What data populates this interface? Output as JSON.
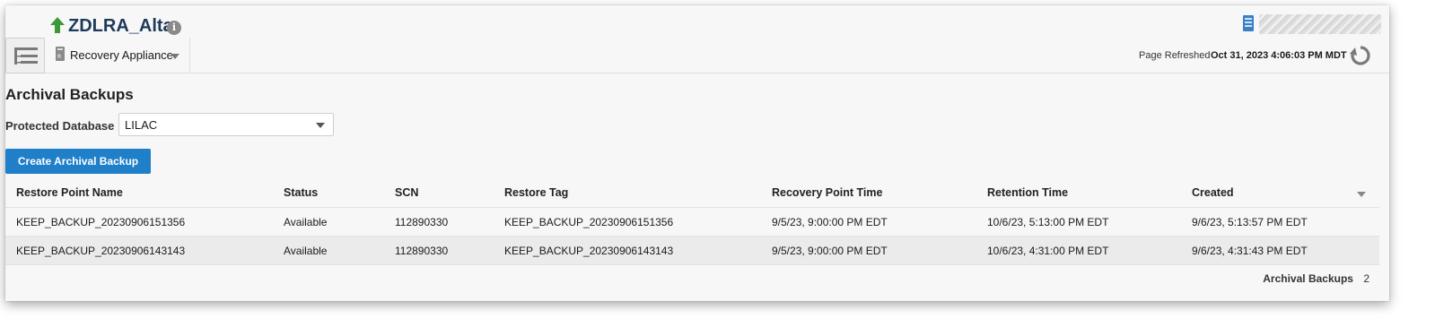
{
  "header": {
    "target_name": "ZDLRA_Alta",
    "status_icon": "up-arrow-icon",
    "status_color": "#3a9a3a",
    "info_icon_glyph": "i"
  },
  "toolbar": {
    "menu_label": "Recovery Appliance",
    "refresh_prefix": "Page Refreshed",
    "refresh_time": "Oct 31, 2023 4:06:03 PM MDT"
  },
  "page": {
    "title": "Archival Backups",
    "db_label": "Protected Database",
    "db_value": "LILAC",
    "create_button": "Create Archival Backup",
    "accent_color": "#1f7fc9"
  },
  "table": {
    "columns": [
      "Restore Point Name",
      "Status",
      "SCN",
      "Restore Tag",
      "Recovery Point Time",
      "Retention Time",
      "Created"
    ],
    "rows": [
      [
        "KEEP_BACKUP_20230906151356",
        "Available",
        "112890330",
        "KEEP_BACKUP_20230906151356",
        "9/5/23, 9:00:00 PM EDT",
        "10/6/23, 5:13:00 PM EDT",
        "9/6/23, 5:13:57 PM EDT"
      ],
      [
        "KEEP_BACKUP_20230906143143",
        "Available",
        "112890330",
        "KEEP_BACKUP_20230906143143",
        "9/5/23, 9:00:00 PM EDT",
        "10/6/23, 4:31:00 PM EDT",
        "9/6/23, 4:31:43 PM EDT"
      ]
    ]
  },
  "footer": {
    "label": "Archival Backups",
    "count": "2"
  }
}
